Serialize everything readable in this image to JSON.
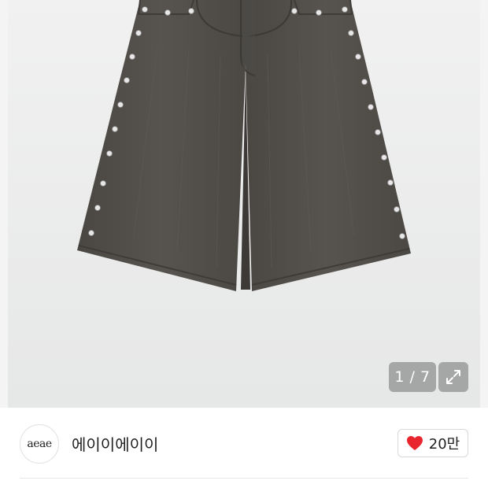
{
  "product": {
    "image_alt": "dark gray studded wide shorts",
    "image_index": "1 / 7"
  },
  "seller": {
    "logo_text": "aeae",
    "name": "에이이에이이"
  },
  "like": {
    "count": "20만",
    "heart_color": "#e8242c"
  },
  "icons": {
    "expand": "expand-icon",
    "heart": "heart-icon"
  }
}
